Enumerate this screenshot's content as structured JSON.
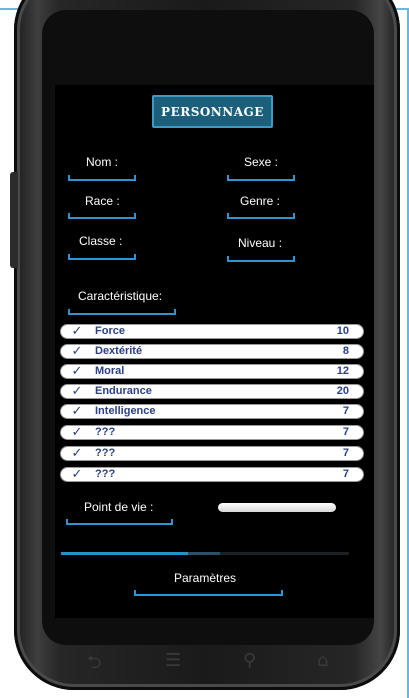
{
  "header": {
    "title": "PERSONNAGE"
  },
  "identity": {
    "nom_label": "Nom :",
    "sexe_label": "Sexe :",
    "race_label": "Race :",
    "genre_label": "Genre :",
    "classe_label": "Classe :",
    "niveau_label": "Niveau :"
  },
  "characteristics": {
    "label": "Caractéristique:",
    "items": [
      {
        "name": "Force",
        "value": "10"
      },
      {
        "name": "Dextérité",
        "value": "8"
      },
      {
        "name": "Moral",
        "value": "12"
      },
      {
        "name": "Endurance",
        "value": "20"
      },
      {
        "name": "Intelligence",
        "value": "7"
      },
      {
        "name": "???",
        "value": "7"
      },
      {
        "name": "???",
        "value": "7"
      },
      {
        "name": "???",
        "value": "7"
      }
    ],
    "check_glyph": "✓"
  },
  "health": {
    "label": "Point de vie :"
  },
  "progress": {
    "value_fraction": 0.44,
    "buffer_fraction": 0.55
  },
  "settings": {
    "label": "Paramètres"
  },
  "nav_icons": [
    "back-icon",
    "menu-icon",
    "search-icon",
    "home-icon"
  ],
  "colors": {
    "accent": "#2f95d0",
    "title_bg": "#1c5f7a",
    "stat_text": "#2a3f86"
  }
}
